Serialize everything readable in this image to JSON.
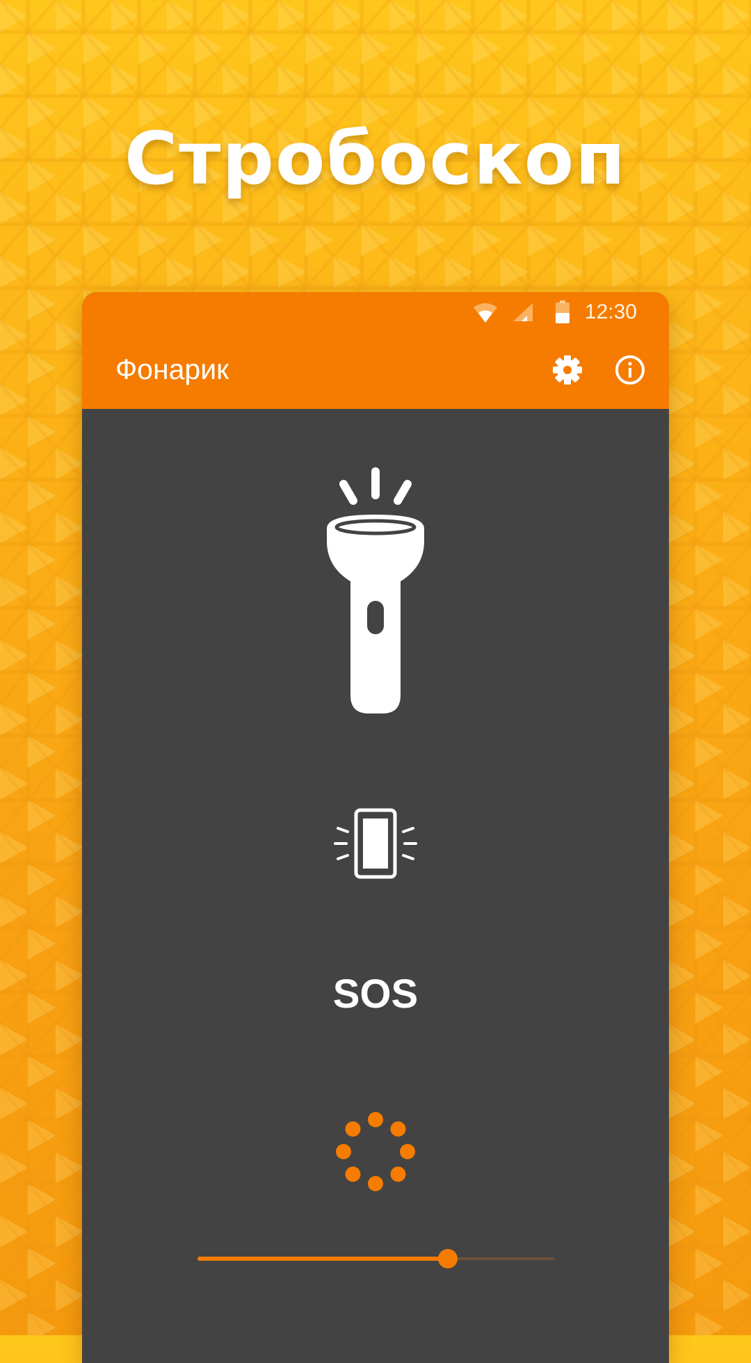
{
  "promo": {
    "title": "Стробоскоп"
  },
  "status_bar": {
    "time": "12:30",
    "icons": [
      "wifi-icon",
      "signal-icon",
      "battery-icon"
    ]
  },
  "app_bar": {
    "title": "Фонарик",
    "actions": [
      {
        "icon": "gear-icon"
      },
      {
        "icon": "info-icon"
      }
    ]
  },
  "modes": {
    "flashlight": {
      "icon": "flashlight-icon"
    },
    "screen_light": {
      "icon": "phone-screen-light-icon"
    },
    "sos": {
      "label": "SOS"
    },
    "strobe": {
      "icon": "strobe-dots-icon"
    }
  },
  "strobe_slider": {
    "value_fraction": 0.7
  },
  "colors": {
    "accent": "#F57C00",
    "background_gradient_top": "#FFC61C",
    "background_gradient_bottom": "#F59A0E",
    "content_background": "#434343",
    "icon_white": "#FFFFFF"
  }
}
